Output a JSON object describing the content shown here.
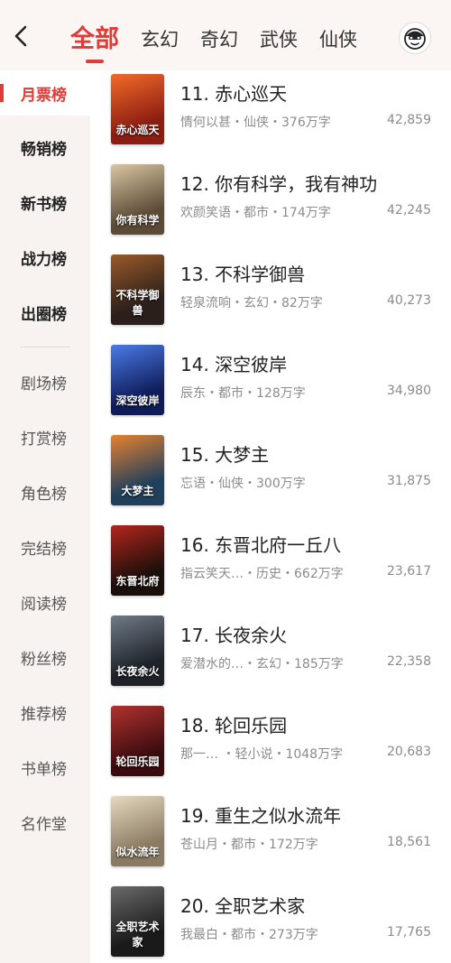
{
  "header": {
    "tabs": [
      "全部",
      "玄幻",
      "奇幻",
      "武侠",
      "仙侠"
    ],
    "active_tab": 0
  },
  "sidebar": {
    "items": [
      "月票榜",
      "畅销榜",
      "新书榜",
      "战力榜",
      "出圈榜",
      "剧场榜",
      "打赏榜",
      "角色榜",
      "完结榜",
      "阅读榜",
      "粉丝榜",
      "推荐榜",
      "书单榜",
      "名作堂"
    ],
    "active_index": 0
  },
  "books": [
    {
      "title": "11. 赤心巡天",
      "meta": "情何以甚・仙侠・376万字",
      "votes": "42,859",
      "cover_text": "赤心巡天",
      "cover_color": "#8c1d12",
      "cover_color2": "#f26b2a"
    },
    {
      "title": "12. 你有科学，我有神功",
      "meta": "欢颜笑语・都市・174万字",
      "votes": "42,245",
      "cover_text": "你有科学",
      "cover_color": "#5b4a36",
      "cover_color2": "#d9c6a3"
    },
    {
      "title": "13. 不科学御兽",
      "meta": "轻泉流响・玄幻・82万字",
      "votes": "40,273",
      "cover_text": "不科学御兽",
      "cover_color": "#2a1f1a",
      "cover_color2": "#9a5a2a"
    },
    {
      "title": "14. 深空彼岸",
      "meta": "辰东・都市・128万字",
      "votes": "34,980",
      "cover_text": "深空彼岸",
      "cover_color": "#0f1c5a",
      "cover_color2": "#4b7be6"
    },
    {
      "title": "15. 大梦主",
      "meta": "忘语・仙侠・300万字",
      "votes": "31,875",
      "cover_text": "大梦主",
      "cover_color": "#1f3f5c",
      "cover_color2": "#e6822f"
    },
    {
      "title": "16. 东晋北府一丘八",
      "meta": "指云笑天…・历史・662万字",
      "votes": "23,617",
      "cover_text": "东晋北府",
      "cover_color": "#1a0f0a",
      "cover_color2": "#b3261e"
    },
    {
      "title": "17. 长夜余火",
      "meta": "爱潜水的…・玄幻・185万字",
      "votes": "22,358",
      "cover_text": "长夜余火",
      "cover_color": "#1e2228",
      "cover_color2": "#707b87"
    },
    {
      "title": "18. 轮回乐园",
      "meta": "那一…   ・轻小说・1048万字",
      "votes": "20,683",
      "cover_text": "轮回乐园",
      "cover_color": "#3a0c0e",
      "cover_color2": "#b1322f"
    },
    {
      "title": "19. 重生之似水流年",
      "meta": "苍山月・都市・172万字",
      "votes": "18,561",
      "cover_text": "似水流年",
      "cover_color": "#8a7a62",
      "cover_color2": "#e6d9bf"
    },
    {
      "title": "20. 全职艺术家",
      "meta": "我最白・都市・273万字",
      "votes": "17,765",
      "cover_text": "全职艺术家",
      "cover_color": "#1a1a1a",
      "cover_color2": "#6b6b6b"
    }
  ]
}
